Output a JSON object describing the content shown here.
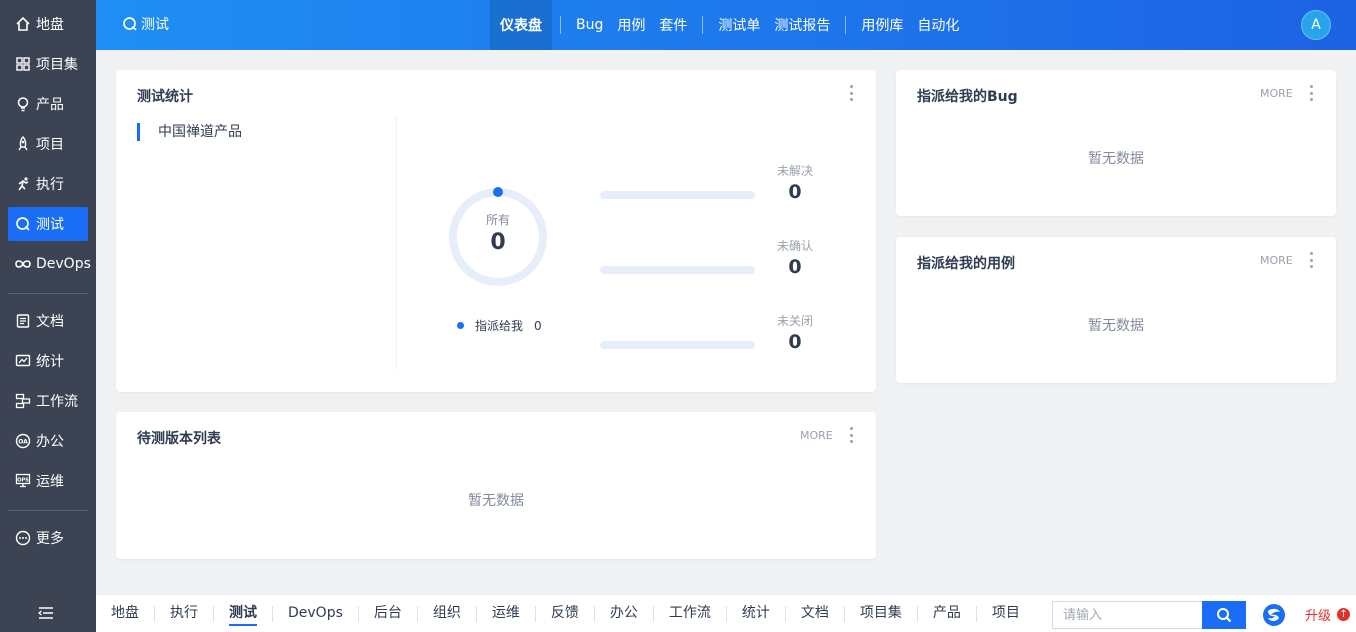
{
  "sidebar": {
    "items": [
      {
        "label": "地盘",
        "icon": "home-icon"
      },
      {
        "label": "项目集",
        "icon": "grid-icon"
      },
      {
        "label": "产品",
        "icon": "bulb-icon"
      },
      {
        "label": "项目",
        "icon": "rocket-icon"
      },
      {
        "label": "执行",
        "icon": "run-icon"
      },
      {
        "label": "测试",
        "icon": "test-icon",
        "active": true
      },
      {
        "label": "DevOps",
        "icon": "infinity-icon"
      },
      {
        "label": "文档",
        "icon": "document-icon"
      },
      {
        "label": "统计",
        "icon": "chart-icon"
      },
      {
        "label": "工作流",
        "icon": "workflow-icon"
      },
      {
        "label": "办公",
        "icon": "oa-icon"
      },
      {
        "label": "运维",
        "icon": "ops-icon"
      },
      {
        "label": "更多",
        "icon": "more-icon"
      }
    ]
  },
  "topbar": {
    "breadcrumb": "测试",
    "nav": [
      "仪表盘",
      "Bug",
      "用例",
      "套件",
      "测试单",
      "测试报告",
      "用例库",
      "自动化"
    ],
    "active_nav": "仪表盘",
    "avatar": "A",
    "gradient_start": "#1f8ef3",
    "gradient_end": "#1d63e4"
  },
  "stats_card": {
    "title": "测试统计",
    "product": "中国禅道产品",
    "all_label": "所有",
    "all_value": "0",
    "legend_label": "指派给我",
    "legend_value": "0",
    "rows": [
      {
        "label": "未解决",
        "value": "0",
        "progress": 0
      },
      {
        "label": "未确认",
        "value": "0",
        "progress": 0
      },
      {
        "label": "未关闭",
        "value": "0",
        "progress": 0
      }
    ]
  },
  "builds_card": {
    "title": "待测版本列表",
    "more": "MORE",
    "empty": "暂无数据"
  },
  "bug_card": {
    "title": "指派给我的Bug",
    "more": "MORE",
    "empty": "暂无数据"
  },
  "case_card": {
    "title": "指派给我的用例",
    "more": "MORE",
    "empty": "暂无数据"
  },
  "bottombar": {
    "nav": [
      "地盘",
      "执行",
      "测试",
      "DevOps",
      "后台",
      "组织",
      "运维",
      "反馈",
      "办公",
      "工作流",
      "统计",
      "文档",
      "项目集",
      "产品",
      "项目"
    ],
    "active_nav": "测试",
    "search_placeholder": "请输入",
    "upgrade": "升级"
  },
  "colors": {
    "accent": "#1a6ef5",
    "sidebar_bg": "#3c4353",
    "upgrade": "#e0322a"
  }
}
